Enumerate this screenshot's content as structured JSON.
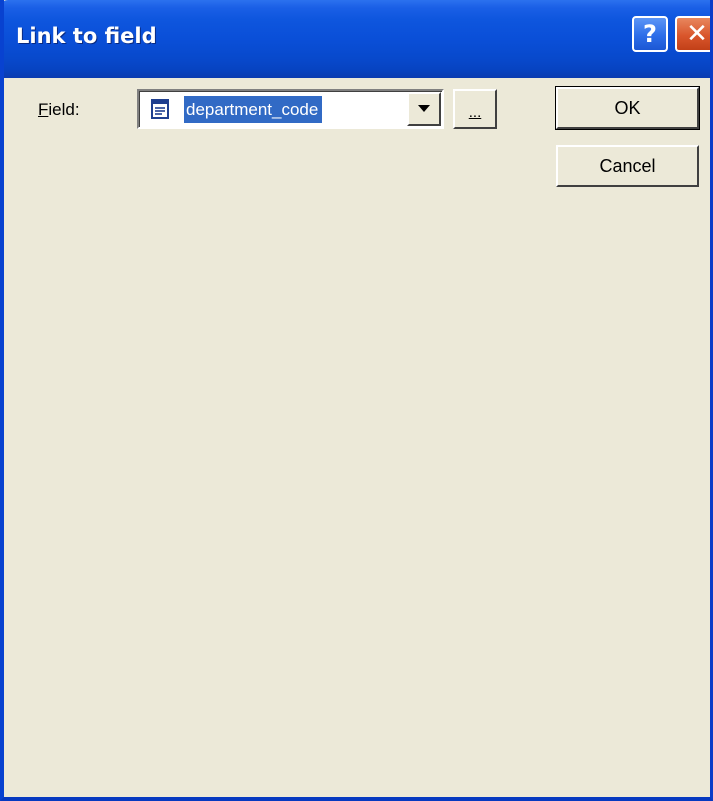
{
  "window": {
    "title": "Link to field",
    "help_button": "?",
    "close_button": "✕"
  },
  "field": {
    "label_accel": "F",
    "label_rest": "ield:",
    "selected_value": "department_code",
    "icon": "document-icon"
  },
  "buttons": {
    "browse": "...",
    "ok": "OK",
    "cancel": "Cancel"
  },
  "colors": {
    "titlebar": "#0a4fd8",
    "dialog_background": "#ece9d8",
    "selection": "#316ac5",
    "close_button": "#d9562c"
  }
}
